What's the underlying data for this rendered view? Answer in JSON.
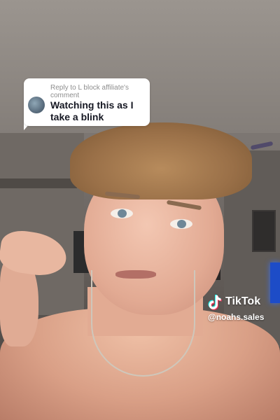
{
  "comment": {
    "reply_header": "Reply to L block affiliate's comment",
    "text": "Watching this as I take a blink"
  },
  "watermark": {
    "brand": "TikTok",
    "handle": "@noahs.sales"
  },
  "colors": {
    "bubble_bg": "#ffffff",
    "header_text": "#8e8e8e",
    "comment_text": "#161823",
    "tiktok_cyan": "#25f4ee",
    "tiktok_red": "#fe2c55"
  },
  "icons": {
    "avatar": "commenter-avatar",
    "logo": "tiktok-logo-icon"
  }
}
